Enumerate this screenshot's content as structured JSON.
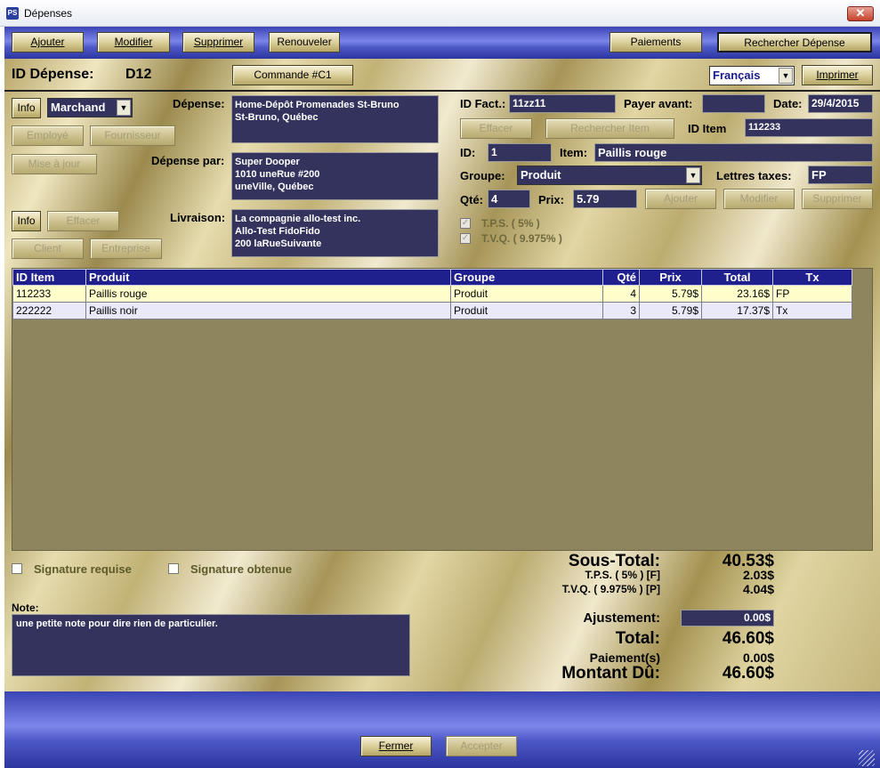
{
  "window": {
    "title": "Dépenses",
    "logo": "PS",
    "close_glyph": "✕"
  },
  "toolbar": {
    "ajouter": "Ajouter",
    "modifier": "Modifier",
    "supprimer": "Supprimer",
    "renouveler": "Renouveler",
    "paiements": "Paiements",
    "rechercher": "Rechercher Dépense"
  },
  "header": {
    "id_label": "ID Dépense:",
    "id_value": "D12",
    "commande": "Commande #C1",
    "language": "Français",
    "imprimer": "Imprimer"
  },
  "left": {
    "info1": "Info",
    "party_type": "Marchand",
    "employe": "Employé",
    "fournisseur": "Fournisseur",
    "mise_a_jour": "Mise à jour",
    "info2": "Info",
    "effacer": "Effacer",
    "client": "Client",
    "entreprise": "Entreprise",
    "depense_label": "Dépense:",
    "depense_value": "Home-Dépôt Promenades St-Bruno\nSt-Bruno, Québec",
    "depense_par_label": "Dépense par:",
    "depense_par_value": "Super Dooper\n1010 uneRue #200\nuneVille, Québec",
    "livraison_label": "Livraison:",
    "livraison_value": "La compagnie allo-test inc.\nAllo-Test FidoFido\n200 laRueSuivante"
  },
  "right": {
    "id_fact_label": "ID Fact.:",
    "id_fact_value": "11zz11",
    "payer_avant_label": "Payer avant:",
    "payer_avant_value": "",
    "date_label": "Date:",
    "date_value": "29/4/2015",
    "effacer": "Effacer",
    "rechercher_item": "Rechercher Item",
    "id_item_label": "ID Item",
    "id_item_value": "112233",
    "id_label": "ID:",
    "id_value": "1",
    "item_label": "Item:",
    "item_value": "Paillis rouge",
    "groupe_label": "Groupe:",
    "groupe_value": "Produit",
    "lettres_taxes_label": "Lettres taxes:",
    "lettres_taxes_value": "FP",
    "qte_label": "Qté:",
    "qte_value": "4",
    "prix_label": "Prix:",
    "prix_value": "5.79",
    "ajouter": "Ajouter",
    "modifier": "Modifier",
    "supprimer": "Supprimer",
    "tps_label": "T.P.S.  ( 5% )",
    "tvq_label": "T.V.Q.  ( 9.975% )"
  },
  "table": {
    "columns": [
      "ID Item",
      "Produit",
      "Groupe",
      "Qté",
      "Prix",
      "Total",
      "Tx"
    ],
    "rows": [
      [
        "112233",
        "Paillis rouge",
        "Produit",
        "4",
        "5.79$",
        "23.16$",
        "FP"
      ],
      [
        "222222",
        "Paillis noir",
        "Produit",
        "3",
        "5.79$",
        "17.37$",
        "Tx"
      ]
    ]
  },
  "signatures": {
    "requise": "Signature requise",
    "obtenue": "Signature obtenue"
  },
  "note": {
    "label": "Note:",
    "value": "une petite note pour dire rien de particulier."
  },
  "totals": {
    "sous_total_label": "Sous-Total:",
    "sous_total_value": "40.53$",
    "tps_label": "T.P.S.  ( 5% ) [F]",
    "tps_value": "2.03$",
    "tvq_label": "T.V.Q.  ( 9.975% ) [P]",
    "tvq_value": "4.04$",
    "ajustement_label": "Ajustement:",
    "ajustement_value": "0.00$",
    "total_label": "Total:",
    "total_value": "46.60$",
    "paiements_label": "Paiement(s)",
    "paiements_value": "0.00$",
    "montant_du_label": "Montant Dû:",
    "montant_du_value": "46.60$"
  },
  "footer": {
    "fermer": "Fermer",
    "accepter": "Accepter"
  },
  "icons": {
    "dropdown": "chevron-down-icon",
    "checkbox_checked": "✓",
    "dropdown_glyph": "▼"
  }
}
